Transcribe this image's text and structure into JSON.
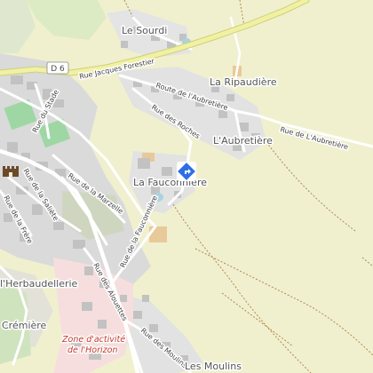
{
  "places": {
    "le_sourdi": "Le Sourdi",
    "la_ripaudiere": "La Ripaudière",
    "aubretiere": "L'Aubretière",
    "la_fauconniere": "La Fauconnière",
    "herbaudellerie": "l'Herbaudellerie",
    "cremiere": "Crémière",
    "les_moulins": "Les Moulins"
  },
  "zone": {
    "line1": "Zone d'activité",
    "line2": "de l'Horizon"
  },
  "road_shield": "D 6",
  "streets": {
    "rue_jacques_forestier": "Rue Jacques Forestier",
    "route_aubretiere": "Route de l'Aubretière",
    "rue_des_roches": "Rue des Roches",
    "rue_de_aubretiere": "Rue de L'Aubretière",
    "rue_du_stade": "Rue du Stade",
    "rue_de_la_marzelle": "Rue de la Marzelle",
    "rue_de_la_saliete": "Rue de la Saliète",
    "rue_de_la_frere": "Rue de la Frère",
    "rue_de_la_fauconniere": "Rue de la Fauconnière",
    "rue_des_alouettes": "Rue des Alouettes",
    "rue_des_moulins": "Rue des Moulins"
  },
  "icons": {
    "location": "directions-marker-icon",
    "castle": "castle-icon"
  },
  "colors": {
    "land": "#f0f0cf",
    "urban": "#dadada",
    "building": "#c2c2c2",
    "primary_road": "#f1f1a3",
    "primary_road_edge": "#cfcf7a",
    "marker": "#2c6ee6",
    "industrial": "#f6dede",
    "sport": "#9ed7a4",
    "zone_text": "#c0392b"
  }
}
